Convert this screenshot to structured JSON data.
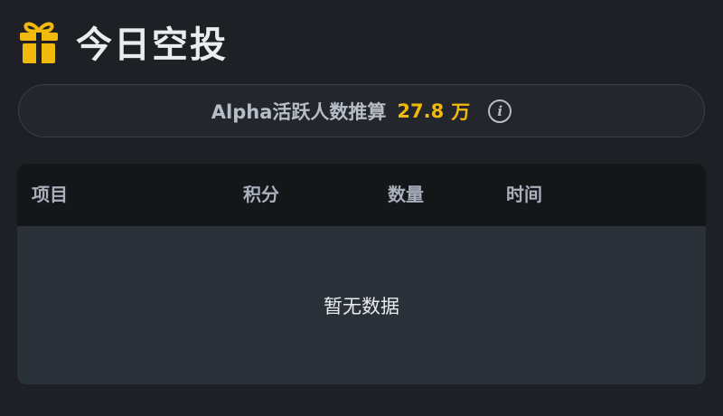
{
  "header": {
    "title": "今日空投",
    "icon": "gift-icon",
    "accent": "#f0b90b"
  },
  "stat": {
    "label": "Alpha活跃人数推算",
    "value": "27.8",
    "unit": "万",
    "info_icon": "info-icon"
  },
  "table": {
    "columns": [
      "项目",
      "积分",
      "数量",
      "时间"
    ],
    "empty_text": "暂无数据"
  }
}
